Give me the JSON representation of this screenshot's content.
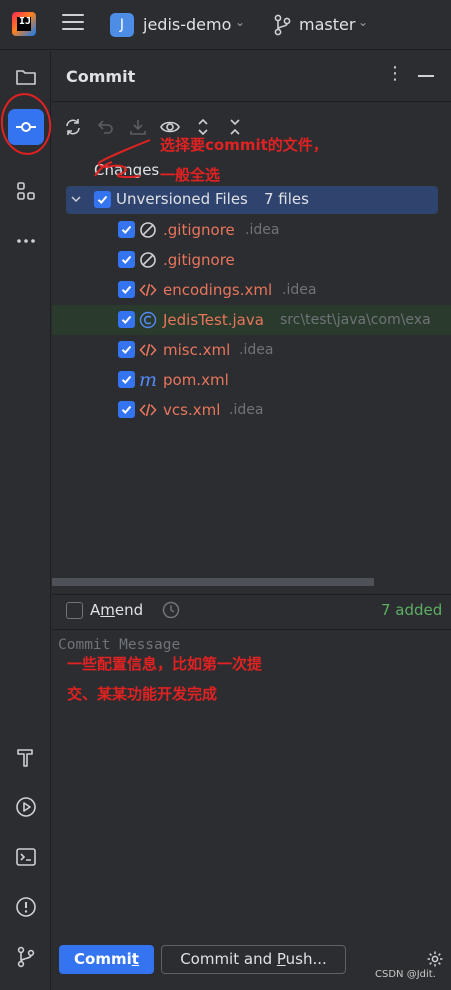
{
  "titlebar": {
    "project_initial": "J",
    "project_name": "jedis-demo",
    "branch_name": "master"
  },
  "toolstrip": {
    "items": [
      "project-icon",
      "commit-icon",
      "structure-icon",
      "more-icon",
      "build-icon",
      "run-icon",
      "terminal-icon",
      "problems-icon",
      "git-icon"
    ]
  },
  "panel": {
    "title": "Commit",
    "changes_label": "Changes",
    "group": {
      "label": "Unversioned Files",
      "count": "7 files"
    },
    "files": [
      {
        "name": ".gitignore",
        "path": ".idea",
        "icon": "ignore-icon",
        "color": "#e8755c"
      },
      {
        "name": ".gitignore",
        "path": "",
        "icon": "ignore-icon",
        "color": "#e8755c"
      },
      {
        "name": "encodings.xml",
        "path": ".idea",
        "icon": "xml-icon",
        "color": "#e8755c"
      },
      {
        "name": "JedisTest.java",
        "path": "src\\test\\java\\com\\exa",
        "icon": "java-class-icon",
        "color": "#e8755c"
      },
      {
        "name": "misc.xml",
        "path": ".idea",
        "icon": "xml-icon",
        "color": "#e8755c"
      },
      {
        "name": "pom.xml",
        "path": "",
        "icon": "maven-icon",
        "color": "#e8755c"
      },
      {
        "name": "vcs.xml",
        "path": ".idea",
        "icon": "xml-icon",
        "color": "#e8755c"
      }
    ],
    "amend_label_pre": "A",
    "amend_label_underline": "m",
    "amend_label_post": "end",
    "added_label": "7 added",
    "message_placeholder": "Commit Message",
    "commit_button_pre": "Commi",
    "commit_button_underline": "t",
    "commit_push_pre": "Commit and ",
    "commit_push_underline": "P",
    "commit_push_post": "ush..."
  },
  "annotations": {
    "line1": "选择要commit的文件，",
    "line2": "一般全选",
    "line3": "一些配置信息，比如第一次提",
    "line4": "交、某某功能开发完成"
  },
  "watermark": "CSDN @Jdit.",
  "colors": {
    "accent": "#3574f0",
    "unversioned": "#e8755c",
    "added": "#5fad65",
    "annotation": "#e02222"
  }
}
